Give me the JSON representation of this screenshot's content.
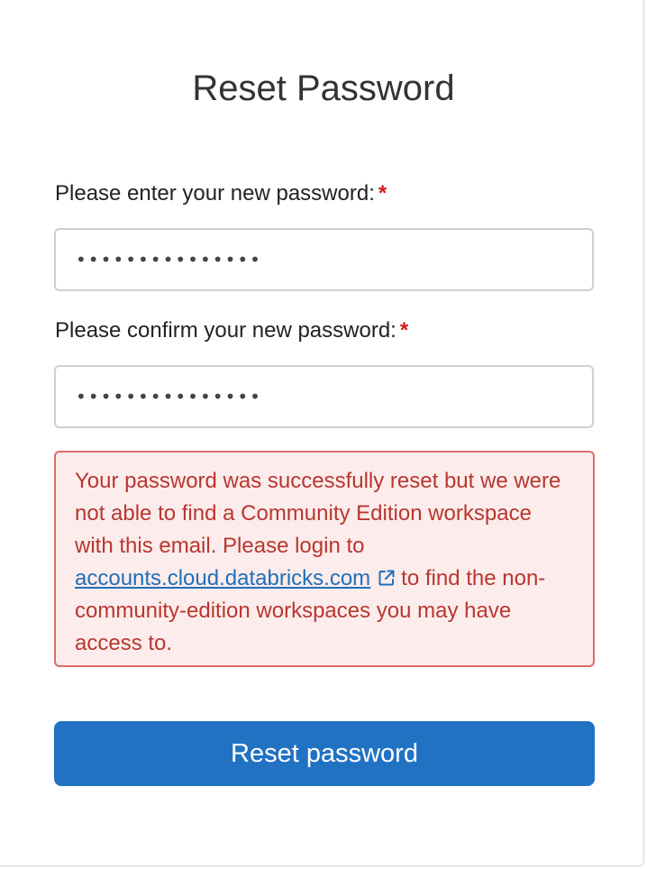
{
  "page": {
    "title": "Reset Password"
  },
  "form": {
    "new_password": {
      "label": "Please enter your new password:",
      "required_marker": "*",
      "value": "•••••••••••••••"
    },
    "confirm_password": {
      "label": "Please confirm your new password:",
      "required_marker": "*",
      "value": "•••••••••••••••"
    },
    "submit_label": "Reset password"
  },
  "alert": {
    "text_before_link": "Your password was successfully reset but we were not able to find a Community Edition workspace with this email. Please login to ",
    "link_text": "accounts.cloud.databricks.com",
    "link_icon": "external-link-icon",
    "text_after_link": "to find the non-community-edition workspaces you may have access to."
  },
  "colors": {
    "primary_button": "#2272c3",
    "error_text": "#b8372f",
    "error_background": "#fdecec",
    "error_border": "#e06b6b",
    "link": "#1f6fb8",
    "required": "#d11a1a"
  }
}
